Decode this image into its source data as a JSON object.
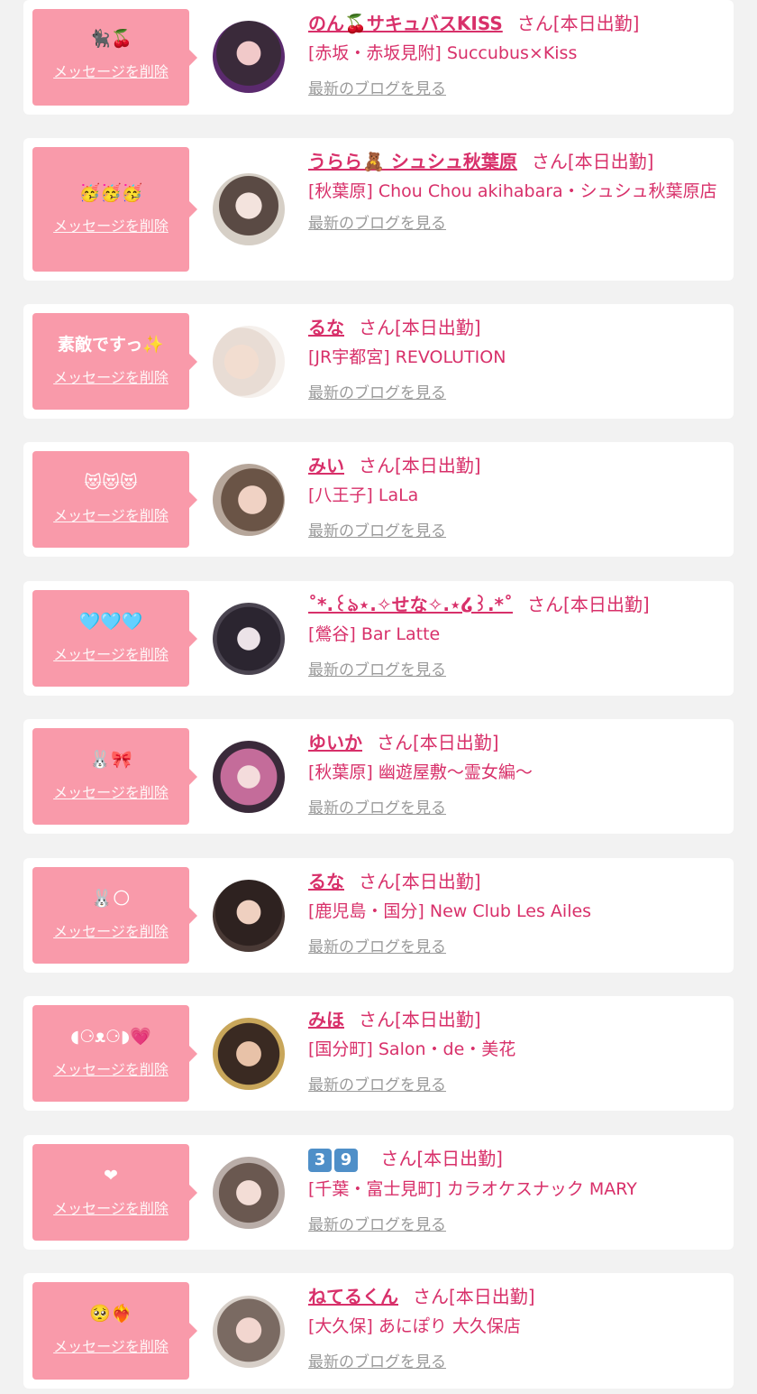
{
  "common": {
    "delete_label": "メッセージを削除",
    "san_label": "さん[本日出勤]",
    "blog_label": "最新のブログを見る"
  },
  "colors": {
    "accent": "#d8306a",
    "bubble": "#f99aaa",
    "background": "#f2f2f2",
    "link_gray": "#9a9a9a"
  },
  "rows": [
    {
      "message": "🐈‍⬛🍒",
      "name": "のん🍒サキュバスKISS",
      "shop": "[赤坂・赤坂見附] Succubus×Kiss"
    },
    {
      "message": "🥳🥳🥳",
      "name": "うらら🧸 シュシュ秋葉原",
      "shop": "[秋葉原] Chou Chou akihabara・シュシュ秋葉原店"
    },
    {
      "message": "素敵ですっ✨",
      "name": "るな",
      "shop": "[JR宇都宮] REVOLUTION"
    },
    {
      "message": "😻😻😻",
      "name": "みい",
      "shop": "[八王子] LaLa"
    },
    {
      "message": "🩵🩵🩵",
      "name": "˚*.꒰ঌ⋆.✧せな✧.⋆໒꒱.*˚",
      "shop": "[鶯谷] Bar Latte"
    },
    {
      "message": "🐰🎀",
      "name": "ゆいか",
      "shop": "[秋葉原] 幽遊屋敷〜霊女編〜"
    },
    {
      "message": "🐰🌕",
      "name": "るな",
      "shop": "[鹿児島・国分] New Club Les Ailes"
    },
    {
      "message": "◖⚆ᴥ⚆◗💗",
      "name": "みほ",
      "shop": "[国分町] Salon・de・美花"
    },
    {
      "message": "❤",
      "name_badges": [
        "3",
        "9"
      ],
      "shop": "[千葉・富士見町] カラオケスナック MARY"
    },
    {
      "message": "🥺❤️‍🔥",
      "name": "ねてるくん",
      "shop": "[大久保] あにぽり 大久保店"
    }
  ]
}
